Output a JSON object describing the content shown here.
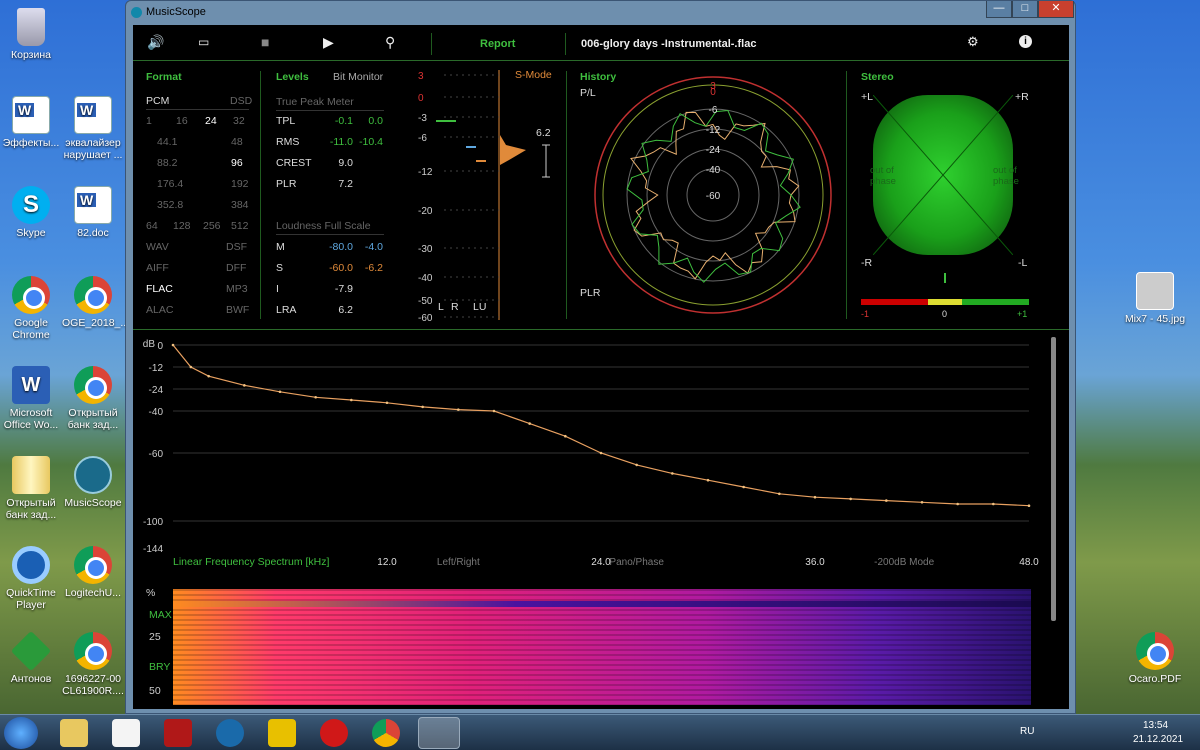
{
  "desktop": {
    "icons": [
      {
        "label": "Корзина",
        "type": "bin"
      },
      {
        "label": "Эффекты...",
        "type": "doc"
      },
      {
        "label": "эквалайзер нарушает ...",
        "type": "doc"
      },
      {
        "label": "Skype",
        "type": "skype"
      },
      {
        "label": "82.doc",
        "type": "doc"
      },
      {
        "label": "Google Chrome",
        "type": "chrome"
      },
      {
        "label": "OGE_2018_...",
        "type": "chrome"
      },
      {
        "label": "Microsoft Office Wo...",
        "type": "word"
      },
      {
        "label": "Открытый банк зад...",
        "type": "chrome"
      },
      {
        "label": "Открытый банк зад...",
        "type": "zip"
      },
      {
        "label": "MusicScope",
        "type": "ms"
      },
      {
        "label": "QuickTime Player",
        "type": "qt"
      },
      {
        "label": "LogitechU...",
        "type": "chrome"
      },
      {
        "label": "Антонов",
        "type": "ant"
      },
      {
        "label": "1696227-00 CL61900R....",
        "type": "chrome"
      },
      {
        "label": "Mix7 - 45.jpg",
        "type": "img"
      },
      {
        "label": "Ocaro.PDF",
        "type": "chrome"
      }
    ]
  },
  "window": {
    "title": "MusicScope",
    "btn_min": "—",
    "btn_max": "□",
    "btn_close": "✕"
  },
  "toolbar": {
    "volume": "🔊",
    "open": "▭",
    "stop": "■",
    "play": "▶",
    "scope": "⚲",
    "report": "Report",
    "file": "006-glory days -Instrumental-.flac",
    "settings": "⚙",
    "info": "i"
  },
  "format": {
    "title": "Format",
    "pcm": "PCM",
    "dsd": "DSD",
    "bits": [
      "1",
      "16",
      "24",
      "32"
    ],
    "rates": [
      [
        "44.1",
        "48"
      ],
      [
        "88.2",
        "96"
      ],
      [
        "176.4",
        "192"
      ],
      [
        "352.8",
        "384"
      ]
    ],
    "dsd_rates": [
      "64",
      "128",
      "256",
      "512"
    ],
    "formats": [
      [
        "WAV",
        "DSF"
      ],
      [
        "AIFF",
        "DFF"
      ],
      [
        "FLAC",
        "MP3"
      ],
      [
        "ALAC",
        "BWF"
      ]
    ]
  },
  "levels": {
    "title": "Levels",
    "bitmon": "Bit Monitor",
    "tpm": "True Peak Meter",
    "rows": [
      [
        "TPL",
        "-0.1",
        "0.0"
      ],
      [
        "RMS",
        "-11.0",
        "-10.4"
      ],
      [
        "CREST",
        "9.0",
        ""
      ],
      [
        "PLR",
        "7.2",
        ""
      ]
    ],
    "lfs": "Loudness Full Scale",
    "lrows": [
      [
        "M",
        "-80.0",
        "-4.0"
      ],
      [
        "S",
        "-60.0",
        "-6.2"
      ],
      [
        "I",
        "-7.9",
        ""
      ],
      [
        "LRA",
        "6.2",
        ""
      ]
    ]
  },
  "meter": {
    "smode": "S-Mode",
    "ticks": [
      "3",
      "0",
      "-3",
      "-6",
      "-12",
      "-20",
      "-30",
      "-40",
      "-50",
      "-60"
    ],
    "peak": "6.2",
    "l": "L",
    "r": "R",
    "lu": "LU"
  },
  "history": {
    "title": "History",
    "pl": "P/L",
    "plr": "PLR",
    "rings": [
      "3",
      "0",
      "-6",
      "-12",
      "-24",
      "-40",
      "-60"
    ]
  },
  "stereo": {
    "title": "Stereo",
    "pl": "+L",
    "pr": "+R",
    "nr": "-R",
    "nl": "-L",
    "out": "out of phase",
    "out2": "out of phase",
    "s_min": "-1",
    "s_mid": "0",
    "s_max": "+1"
  },
  "spectrum": {
    "yticks": [
      "dB",
      "0",
      "-12",
      "-24",
      "-40",
      "-60",
      "-100",
      "-144"
    ],
    "label": "Linear Frequency Spectrum [kHz]",
    "xticks": [
      "12.0",
      "Left/Right",
      "Pano/Phase",
      "24.0",
      "-200dB Mode",
      "36.0",
      "48.0"
    ]
  },
  "spectrogram": {
    "ticks": [
      "%",
      "MAX",
      "25",
      "BRY",
      "50"
    ]
  },
  "taskbar": {
    "lang": "RU",
    "time": "13:54",
    "date": "21.12.2021"
  },
  "chart_data": {
    "type": "line",
    "xlabel": "Linear Frequency Spectrum [kHz]",
    "xlim": [
      0,
      48
    ],
    "ylim": [
      -144,
      0
    ],
    "x": [
      0,
      1,
      2,
      4,
      6,
      8,
      10,
      12,
      14,
      16,
      18,
      20,
      22,
      24,
      26,
      28,
      30,
      32,
      34,
      36,
      38,
      40,
      42,
      44,
      46,
      48
    ],
    "y": [
      0,
      -12,
      -17,
      -22,
      -26,
      -30,
      -32,
      -34,
      -37,
      -39,
      -40,
      -46,
      -52,
      -60,
      -67,
      -72,
      -76,
      -80,
      -84,
      -86,
      -87,
      -88,
      -89,
      -90,
      -90,
      -91
    ]
  }
}
